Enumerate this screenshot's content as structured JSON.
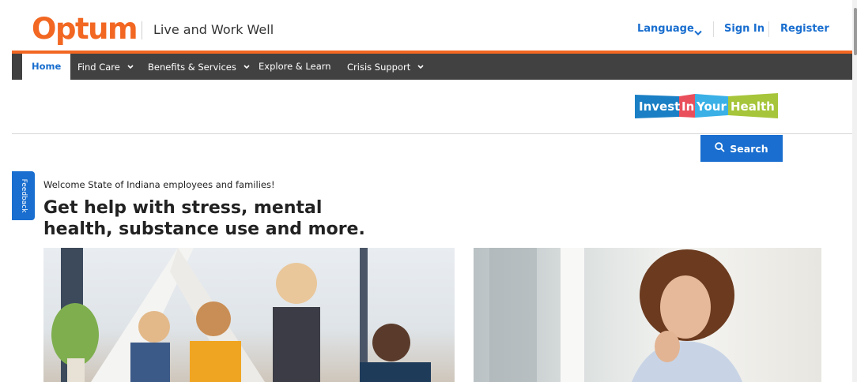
{
  "header": {
    "logo": "Optum",
    "tagline": "Live and Work Well",
    "utility": {
      "language": "Language",
      "sign_in": "Sign In",
      "register": "Register"
    }
  },
  "nav": {
    "items": [
      {
        "label": "Home"
      },
      {
        "label": "Find Care"
      },
      {
        "label": "Benefits & Services"
      },
      {
        "label": "Explore & Learn"
      },
      {
        "label": "Crisis Support"
      }
    ]
  },
  "banner": {
    "invest_logo": [
      "Invest",
      "In",
      "Your",
      "Health"
    ],
    "search_label": "Search"
  },
  "feedback_label": "Feedback",
  "hero": {
    "welcome": "Welcome State of Indiana employees and families!",
    "headline": "Get help with stress, mental health, substance use and more."
  },
  "colors": {
    "brand_orange": "#f26722",
    "nav_bg": "#414141",
    "link_blue": "#196ecf",
    "invest_blue": "#1a7fc4",
    "invest_red": "#e94f5b",
    "invest_lightblue": "#3ab0e6",
    "invest_green": "#a6c53a"
  }
}
